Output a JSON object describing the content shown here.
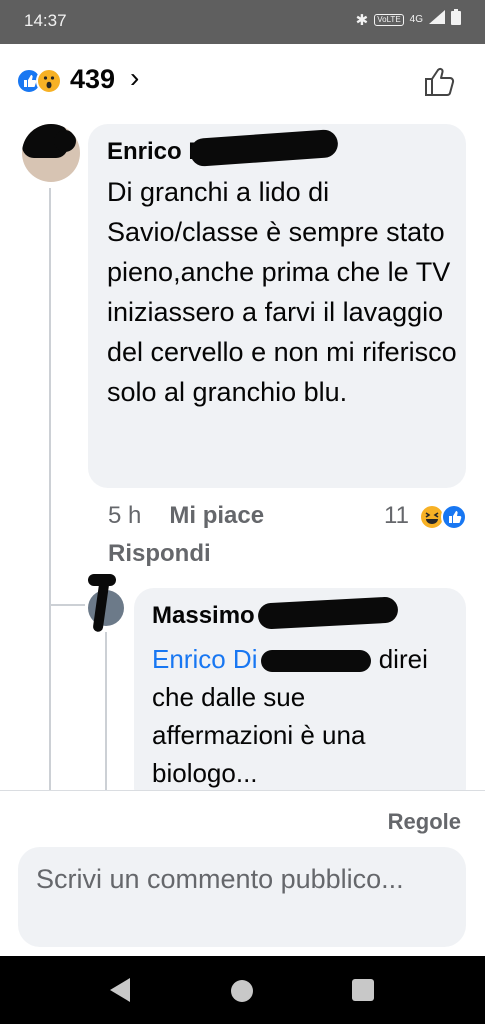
{
  "status_bar": {
    "time": "14:37",
    "icons": [
      "bluetooth-icon",
      "volte-icon",
      "4g-signal-icon",
      "battery-icon"
    ],
    "volte_label": "VoLTE",
    "network_label": "4G"
  },
  "reactions": {
    "types": [
      "like",
      "wow"
    ],
    "count": "439",
    "chevron": "›"
  },
  "comments": [
    {
      "author": "Enrico Di",
      "text": "Di granchi a lido di Savio/classe è sempre stato pieno,anche prima che le TV iniziassero a farvi il lavaggio del cervello e non mi riferisco solo al granchio blu.",
      "time": "5 h",
      "like_label": "Mi piace",
      "reply_label": "Rispondi",
      "reaction_count": "11",
      "reaction_types": [
        "haha",
        "like"
      ]
    },
    {
      "author": "Massimo",
      "mention": "Enrico Di",
      "text": "direi che dalle sue affermazioni è una biologo..."
    }
  ],
  "footer": {
    "rules_label": "Regole",
    "comment_placeholder": "Scrivi un commento pubblico..."
  },
  "colors": {
    "accent": "#1877f2",
    "bubble": "#f0f2f5",
    "secondary_text": "#65676b",
    "status_bar": "#5f5f5f"
  }
}
